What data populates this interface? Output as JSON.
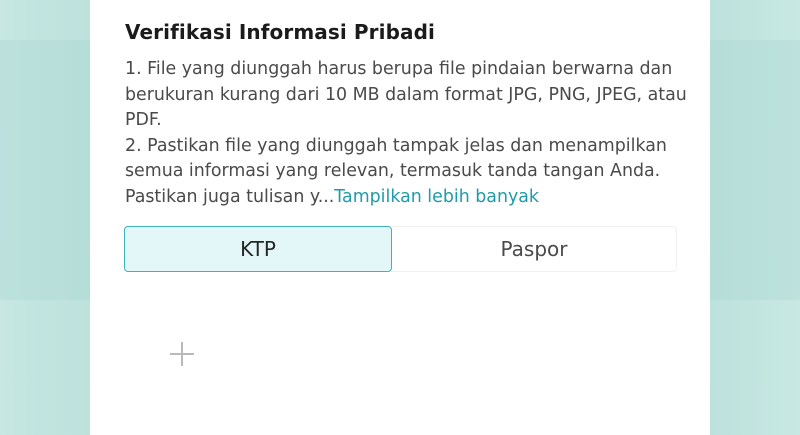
{
  "section": {
    "title": "Verifikasi Informasi Pribadi",
    "description_line1": "1. File yang diunggah harus berupa file pindaian berwarna dan berukuran kurang dari 10 MB dalam format JPG, PNG, JPEG, atau PDF.",
    "description_line2": "2. Pastikan file yang diunggah tampak jelas dan menampilkan semua informasi yang relevan, termasuk tanda tangan Anda. Pastikan juga tulisan y...",
    "more_link": "Tampilkan lebih banyak"
  },
  "tabs": [
    {
      "label": "KTP",
      "selected": true
    },
    {
      "label": "Paspor",
      "selected": false
    }
  ],
  "upload": {
    "icon": "plus-icon"
  },
  "colors": {
    "accent": "#1f9ba9",
    "selected_tab_bg": "#e4f7f8",
    "selected_tab_border": "#3fb2bd",
    "background": "#cfeae6"
  }
}
